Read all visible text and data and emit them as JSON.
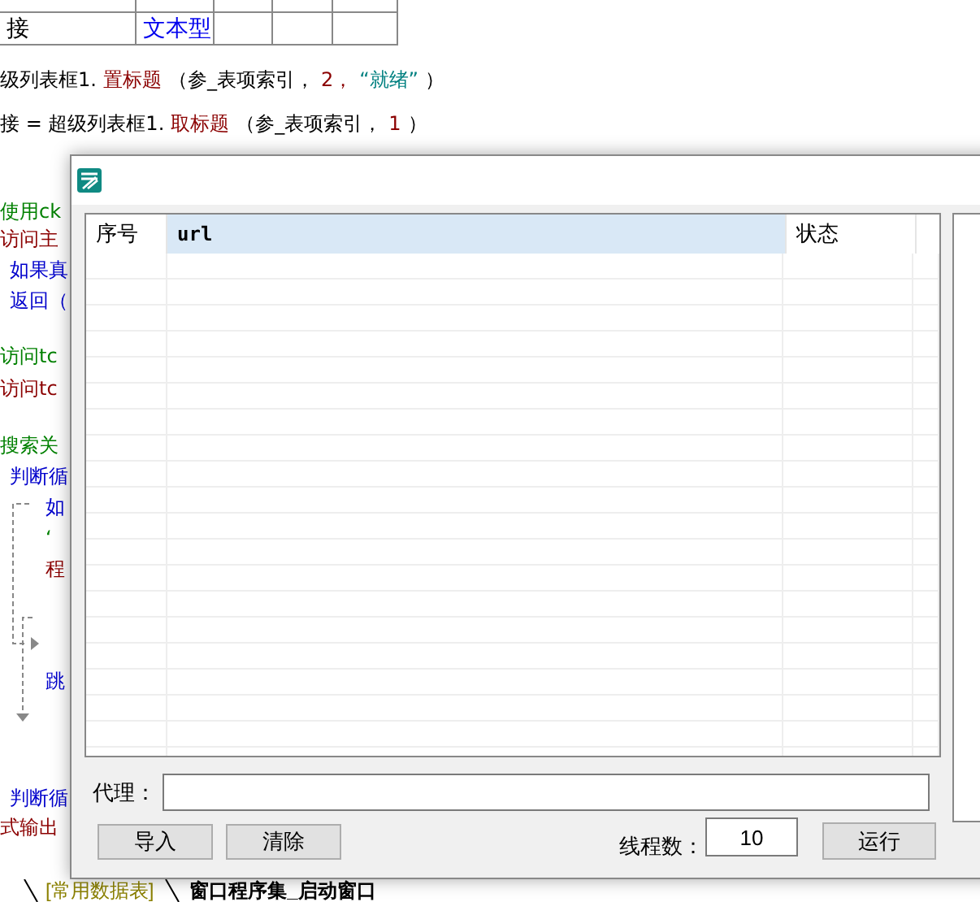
{
  "type_table": {
    "rows": [
      {
        "name": "接",
        "type": "文本型"
      }
    ]
  },
  "code_lines": [
    {
      "segments": [
        {
          "text": "级列表框1.",
          "kind": "plain"
        },
        {
          "text": "置标题",
          "kind": "command"
        },
        {
          "text": "（参_表项索引，",
          "kind": "plain"
        },
        {
          "text": "2，",
          "kind": "number"
        },
        {
          "text": "“就绪”",
          "kind": "string"
        },
        {
          "text": "）",
          "kind": "plain"
        }
      ]
    },
    {
      "segments": [
        {
          "text": "接 = 超级列表框1.",
          "kind": "plain"
        },
        {
          "text": "取标题",
          "kind": "command"
        },
        {
          "text": "（参_表项索引，",
          "kind": "plain"
        },
        {
          "text": "1",
          "kind": "number"
        },
        {
          "text": "）",
          "kind": "plain"
        }
      ]
    },
    {
      "segments": [
        {
          "text": "使用ck",
          "kind": "comment"
        }
      ]
    },
    {
      "segments": [
        {
          "text": "访问主",
          "kind": "command"
        }
      ]
    },
    {
      "segments": [
        {
          "text": "如果真",
          "kind": "keyword"
        }
      ]
    },
    {
      "segments": [
        {
          "text": "返回（",
          "kind": "keyword"
        }
      ]
    },
    {
      "segments": [
        {
          "text": "访问tc",
          "kind": "comment"
        }
      ]
    },
    {
      "segments": [
        {
          "text": "访问tc",
          "kind": "command"
        }
      ]
    },
    {
      "segments": [
        {
          "text": "搜索关",
          "kind": "comment"
        }
      ]
    },
    {
      "segments": [
        {
          "text": "判断循",
          "kind": "keyword"
        }
      ]
    },
    {
      "segments": [
        {
          "text": "如",
          "kind": "keyword"
        }
      ]
    },
    {
      "segments": [
        {
          "text": "‘",
          "kind": "comment"
        }
      ]
    },
    {
      "segments": [
        {
          "text": "程",
          "kind": "command"
        }
      ]
    },
    {
      "segments": [
        {
          "text": "跳",
          "kind": "keyword"
        }
      ]
    },
    {
      "segments": [
        {
          "text": "判断循",
          "kind": "keyword"
        }
      ]
    },
    {
      "segments": [
        {
          "text": "式输出",
          "kind": "command"
        }
      ]
    }
  ],
  "dialog": {
    "list": {
      "columns": [
        {
          "label": "序号",
          "selected": false
        },
        {
          "label": "url",
          "selected": true
        },
        {
          "label": "状态",
          "selected": false
        }
      ]
    },
    "proxy": {
      "label": "代理："
    },
    "buttons": [
      "导入",
      "清除"
    ],
    "threads": {
      "label": "线程数：",
      "value": "10"
    },
    "run_button": "运行"
  },
  "bottom_tabs": [
    {
      "label": "[常用数据表]",
      "selected": false
    },
    {
      "label": "窗口程序集_启动窗口",
      "selected": true
    }
  ]
}
